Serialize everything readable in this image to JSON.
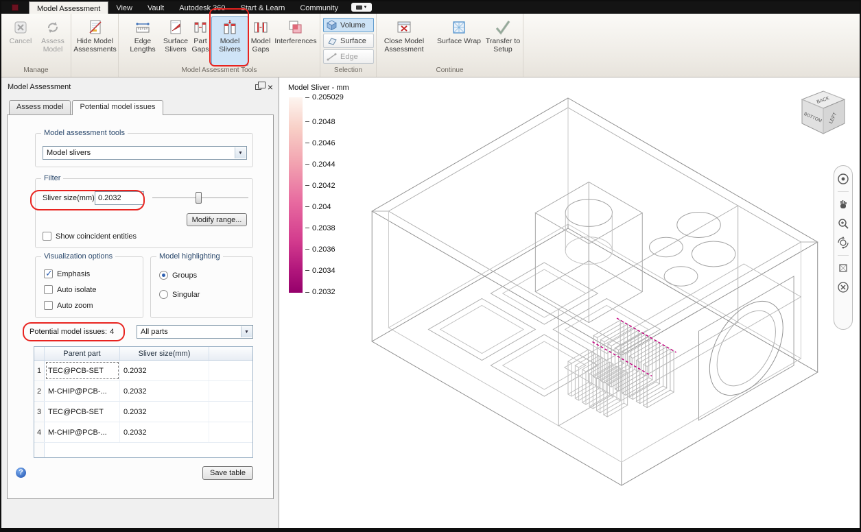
{
  "ribbon": {
    "tabs": [
      {
        "label": "Model Assessment"
      },
      {
        "label": "View"
      },
      {
        "label": "Vault"
      },
      {
        "label": "Autodesk 360"
      },
      {
        "label": "Start & Learn"
      },
      {
        "label": "Community"
      }
    ],
    "groups": {
      "manage": {
        "caption": "Manage",
        "cancel": "Cancel",
        "assess_model": "Assess Model"
      },
      "hide": {
        "hide_model_assessments": "Hide Model Assessments"
      },
      "tools": {
        "caption": "Model Assessment Tools",
        "edge_lengths": "Edge Lengths",
        "surface_slivers": "Surface Slivers",
        "part_gaps": "Part Gaps",
        "model_slivers": "Model Slivers",
        "model_gaps": "Model Gaps",
        "interferences": "Interferences"
      },
      "selection": {
        "caption": "Selection",
        "volume": "Volume",
        "surface": "Surface",
        "edge": "Edge"
      },
      "continue": {
        "caption": "Continue",
        "close_model_assessment": "Close Model Assessment",
        "surface_wrap": "Surface Wrap",
        "transfer_to_setup": "Transfer to Setup"
      }
    }
  },
  "panel": {
    "title": "Model Assessment",
    "tabs": {
      "assess": "Assess model",
      "issues": "Potential model issues"
    },
    "assessment_tools": {
      "group_label": "Model assessment tools",
      "selected": "Model slivers"
    },
    "filter": {
      "group_label": "Filter",
      "sliver_size_label": "Sliver size(mm)",
      "sliver_size_value": "0.2032",
      "modify_range": "Modify range...",
      "show_coincident": "Show coincident entities"
    },
    "visualization": {
      "group_label": "Visualization options",
      "emphasis": "Emphasis",
      "auto_isolate": "Auto isolate",
      "auto_zoom": "Auto zoom"
    },
    "highlighting": {
      "group_label": "Model highlighting",
      "groups": "Groups",
      "singular": "Singular"
    },
    "issues_summary": {
      "label": "Potential model issues:",
      "count": "4",
      "parts_filter": "All parts"
    },
    "table": {
      "headers": {
        "part": "Parent part",
        "size": "Sliver size(mm)"
      },
      "rows": [
        {
          "num": "1",
          "part": "TEC@PCB-SET",
          "size": "0.2032"
        },
        {
          "num": "2",
          "part": "M-CHIP@PCB-...",
          "size": "0.2032"
        },
        {
          "num": "3",
          "part": "TEC@PCB-SET",
          "size": "0.2032"
        },
        {
          "num": "4",
          "part": "M-CHIP@PCB-...",
          "size": "0.2032"
        }
      ]
    },
    "help": "?",
    "save_table": "Save table"
  },
  "viewport": {
    "legend": {
      "title": "Model Sliver - mm",
      "ticks": [
        "0.205029",
        "0.2048",
        "0.2046",
        "0.2044",
        "0.2042",
        "0.204",
        "0.2038",
        "0.2036",
        "0.2034",
        "0.2032"
      ],
      "top_color": "#fdf5f0",
      "bottom_color": "#95006b"
    },
    "viewcube": {
      "faces": [
        "BACK",
        "BOTTOM",
        "LEFT"
      ]
    },
    "navbar_icons": [
      "navigation-wheel",
      "pan",
      "zoom",
      "orbit",
      "look-at",
      "close"
    ]
  },
  "colors": {
    "annotation_red": "#e8231f",
    "selection_blue_bg": "#cfe4f7",
    "sliver_highlight": "#c4007e"
  }
}
